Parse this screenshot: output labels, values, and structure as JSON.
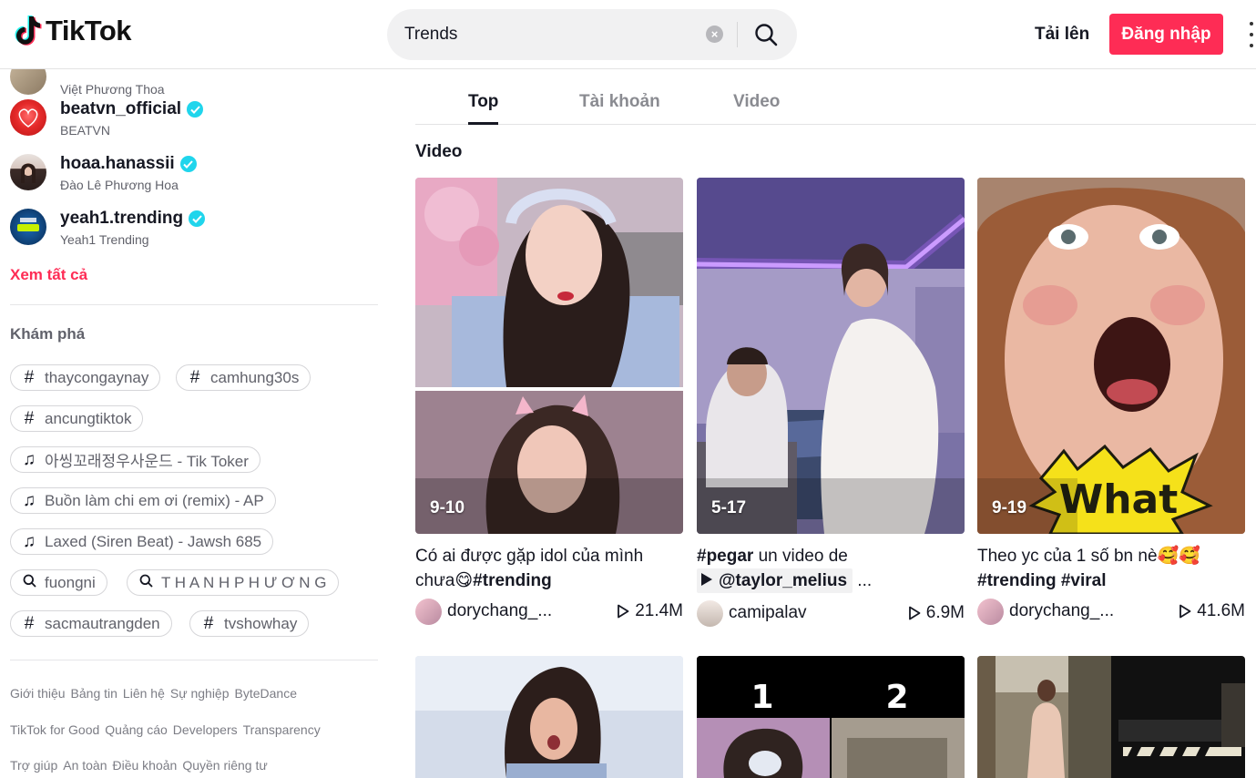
{
  "header": {
    "logo_text": "TikTok",
    "search_value": "Trends",
    "upload_label": "Tải lên",
    "login_label": "Đăng nhập"
  },
  "sidebar": {
    "accounts": [
      {
        "name": "",
        "sub": "Việt Phương Thoa"
      },
      {
        "name": "beatvn_official",
        "sub": "BEATVN"
      },
      {
        "name": "hoaa.hanassii",
        "sub": "Đào Lê Phương Hoa"
      },
      {
        "name": "yeah1.trending",
        "sub": "Yeah1 Trending"
      }
    ],
    "see_all": "Xem tất cả",
    "discover_title": "Khám phá",
    "chips": [
      {
        "icon": "hashtag-icon",
        "label": "thaycongaynay"
      },
      {
        "icon": "hashtag-icon",
        "label": "camhung30s"
      },
      {
        "icon": "hashtag-icon",
        "label": "ancungtiktok"
      },
      {
        "icon": "music-note-icon",
        "label": "아씽꼬래정우사운드 - Tik Toker"
      },
      {
        "icon": "music-note-icon",
        "label": "Buồn làm chi em ơi (remix) - AP"
      },
      {
        "icon": "music-note-icon",
        "label": "Laxed (Siren Beat) - Jawsh 685"
      },
      {
        "icon": "search-icon",
        "label": "fuongni"
      },
      {
        "icon": "search-icon",
        "label": "T H A N H P H Ư Ơ N G"
      },
      {
        "icon": "hashtag-icon",
        "label": "sacmautrangden"
      },
      {
        "icon": "hashtag-icon",
        "label": "tvshowhay"
      }
    ],
    "footer": [
      [
        "Giới thiệu",
        "Bảng tin",
        "Liên hệ",
        "Sự nghiệp",
        "ByteDance"
      ],
      [
        "TikTok for Good",
        "Quảng cáo",
        "Developers",
        "Transparency"
      ],
      [
        "Trợ giúp",
        "An toàn",
        "Điều khoản",
        "Quyền riêng tư"
      ]
    ]
  },
  "tabs": [
    "Top",
    "Tài khoản",
    "Video"
  ],
  "section_title": "Video",
  "videos": [
    {
      "label": "9-10",
      "caption_text": "Có ai được gặp idol của mình chưa",
      "caption_emoji": "😋",
      "caption_tag": "#trending",
      "user": "dorychang_...",
      "views": "21.4M"
    },
    {
      "label": "5-17",
      "caption_tag": "#pegar",
      "caption_text": " un video de",
      "mention": "@taylor_melius",
      "mention_suffix": " ...",
      "user": "camipalav",
      "views": "6.9M"
    },
    {
      "label": "9-19",
      "caption_text": "Theo yc của 1 số bn nè",
      "caption_emoji": "🥰🥰",
      "caption_tag": "#trending #viral",
      "user": "dorychang_...",
      "views": "41.6M",
      "overlay_text": "What"
    }
  ],
  "second_row": {
    "labels": [
      "1",
      "2"
    ]
  },
  "colors": {
    "brand": "#fe2c55",
    "verified": "#20d5ec"
  }
}
